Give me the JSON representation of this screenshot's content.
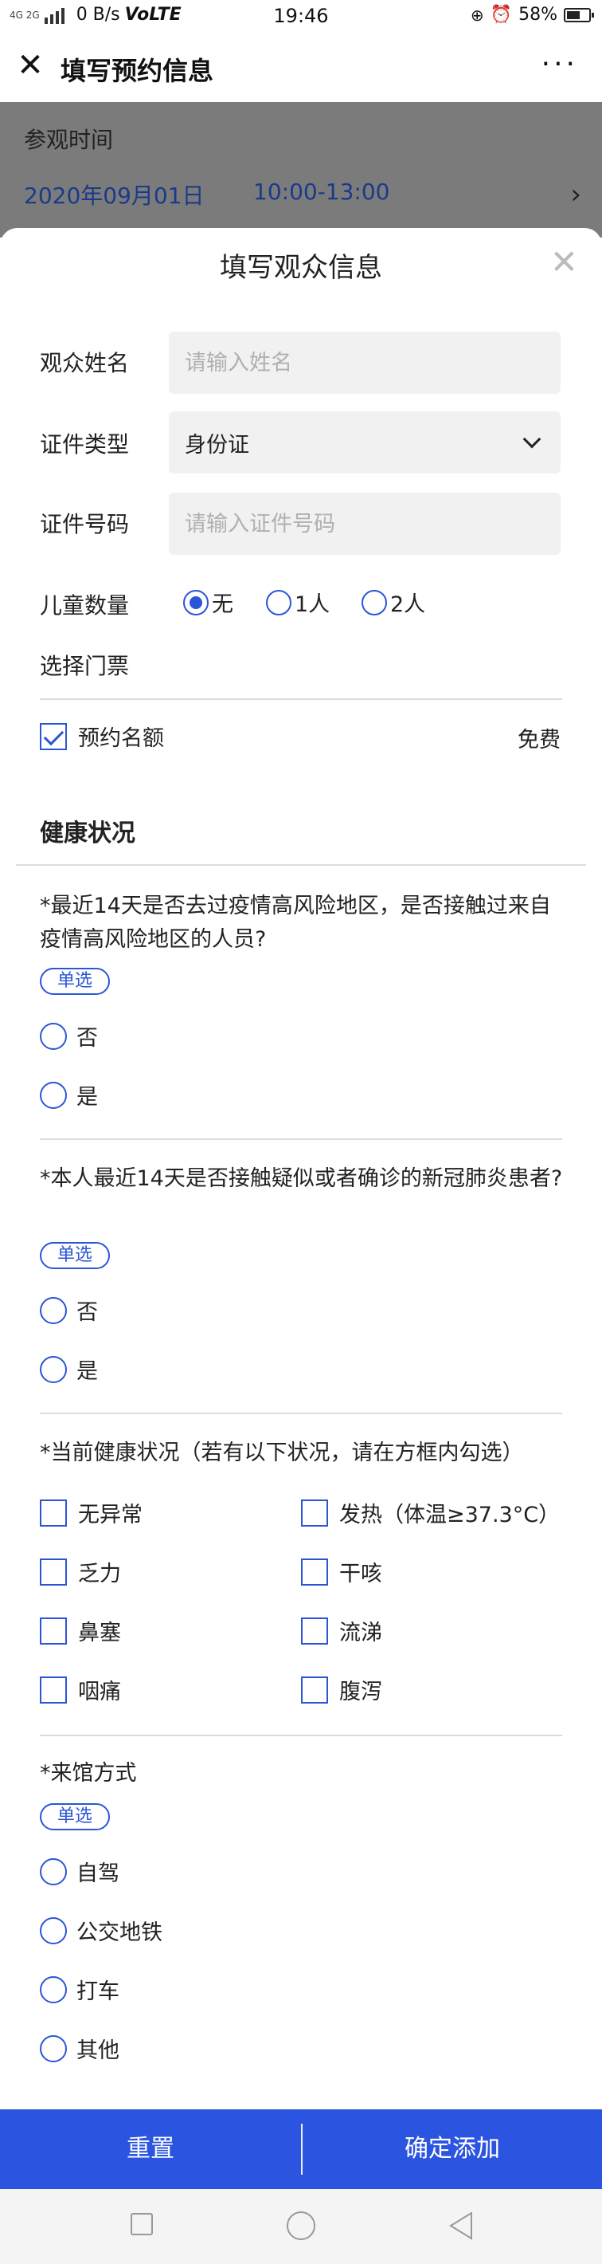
{
  "status_bar": {
    "signal_text": "4G 2G",
    "net_speed": "0 B/s",
    "volte": "VoLTE",
    "time": "19:46",
    "battery": "58%"
  },
  "navbar": {
    "title": "填写预约信息",
    "more": "···"
  },
  "background_page": {
    "label": "参观时间",
    "date": "2020年09月01日",
    "time_slot": "10:00-13:00"
  },
  "sheet": {
    "title": "填写观众信息"
  },
  "form": {
    "name_label": "观众姓名",
    "name_placeholder": "请输入姓名",
    "id_type_label": "证件类型",
    "id_type_value": "身份证",
    "id_number_label": "证件号码",
    "id_number_placeholder": "请输入证件号码",
    "children_label": "儿童数量",
    "children_options": [
      "无",
      "1人",
      "2人"
    ],
    "children_selected": "无",
    "ticket_label": "选择门票",
    "ticket_name": "预约名额",
    "ticket_checked": true,
    "ticket_price": "免费"
  },
  "health": {
    "title": "健康状况",
    "single_badge": "单选",
    "q1": {
      "text": "*最近14天是否去过疫情高风险地区，是否接触过来自疫情高风险地区的人员?",
      "options": [
        "否",
        "是"
      ]
    },
    "q2": {
      "text": "*本人最近14天是否接触疑似或者确诊的新冠肺炎患者?",
      "options": [
        "否",
        "是"
      ]
    },
    "q3": {
      "text": "*当前健康状况（若有以下状况，请在方框内勾选）",
      "options": [
        "无异常",
        "发热（体温≥37.3°C）",
        "乏力",
        "干咳",
        "鼻塞",
        "流涕",
        "咽痛",
        "腹泻"
      ]
    },
    "q4": {
      "text": "*来馆方式",
      "options": [
        "自驾",
        "公交地铁",
        "打车",
        "其他"
      ]
    }
  },
  "footer": {
    "reset": "重置",
    "confirm": "确定添加"
  },
  "colors": {
    "accent": "#2b55d6",
    "bottom_bar": "#2b55e0"
  }
}
